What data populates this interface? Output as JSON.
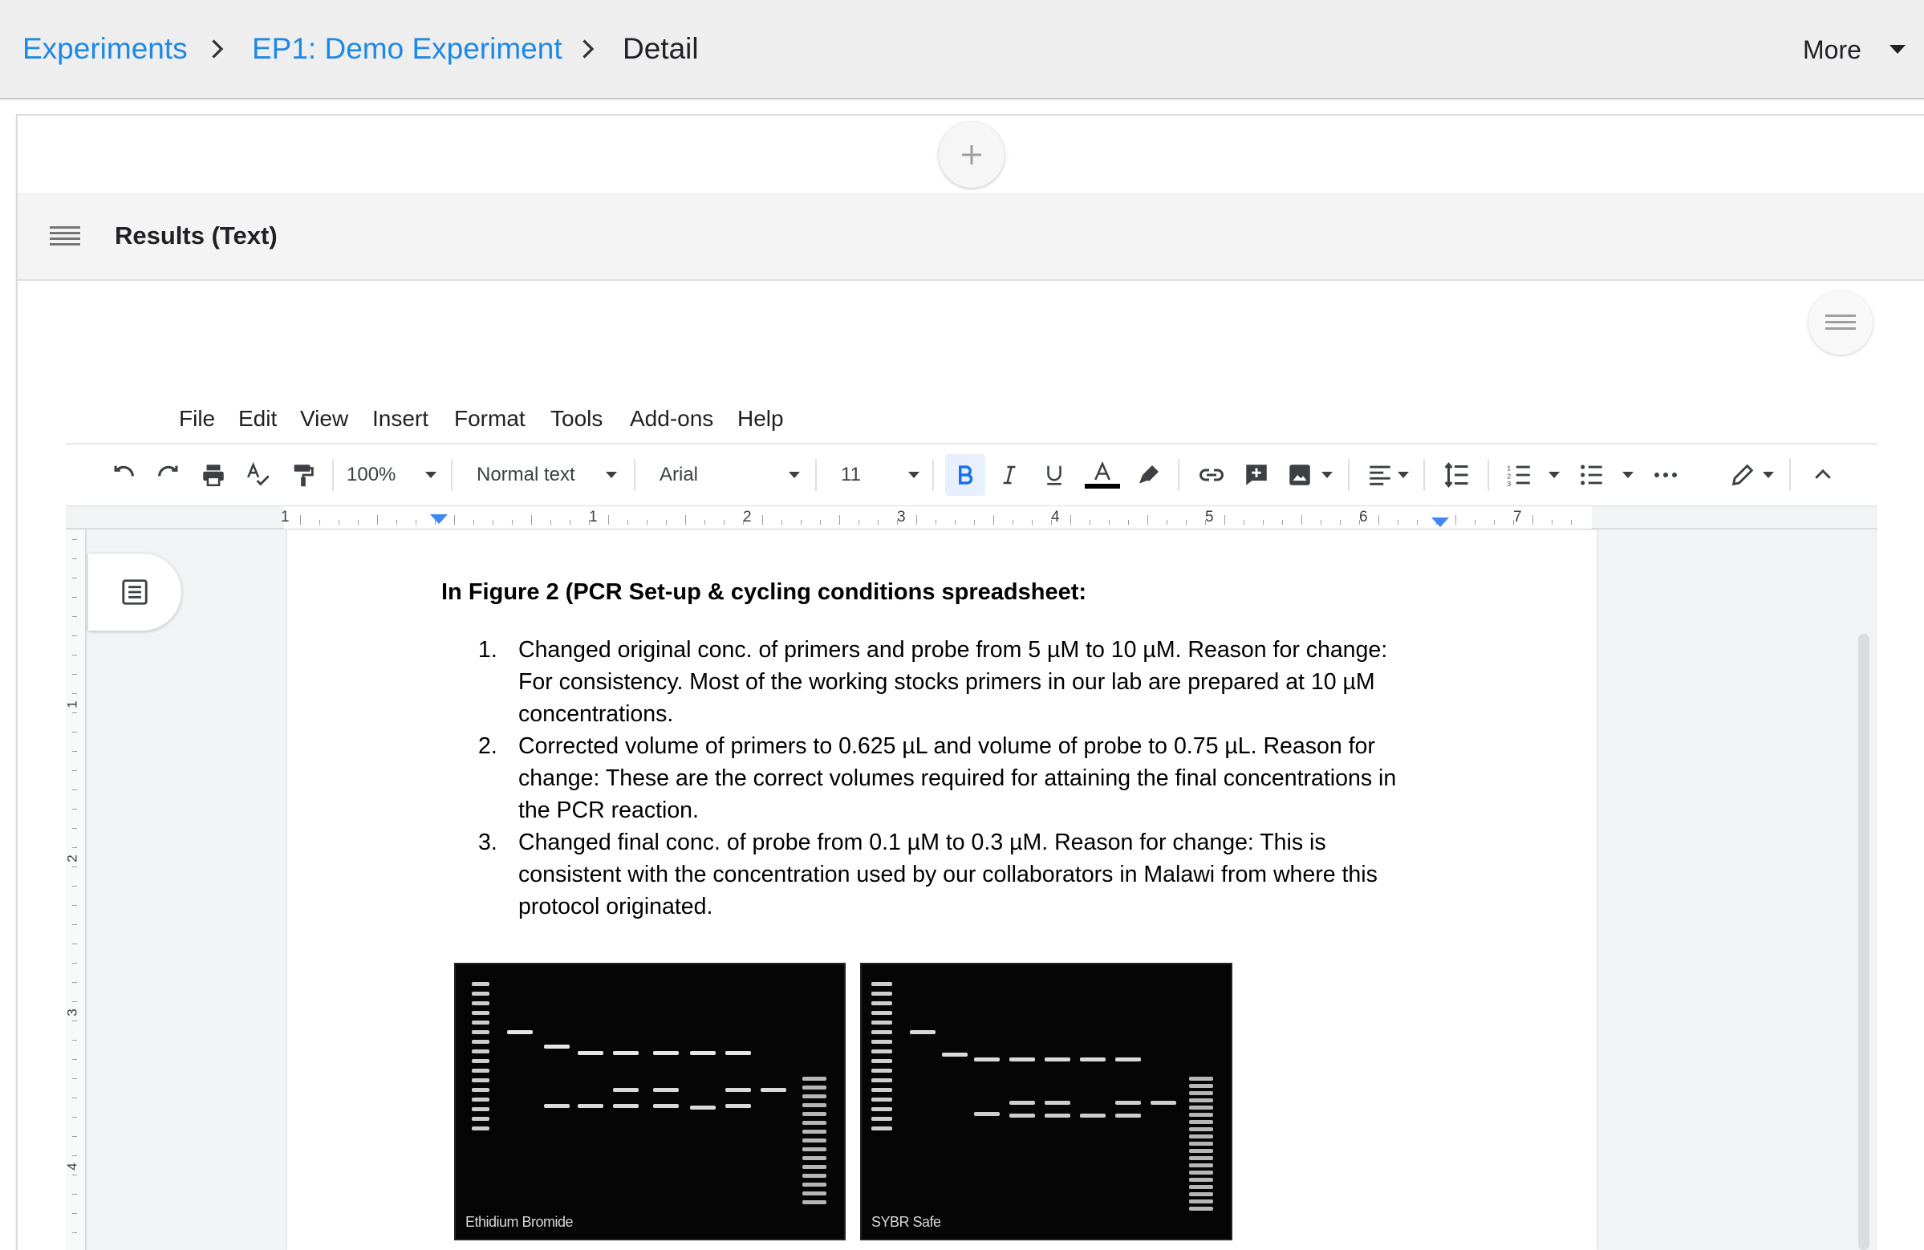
{
  "breadcrumb": {
    "experiments": "Experiments",
    "experiment": "EP1: Demo Experiment",
    "current": "Detail"
  },
  "header": {
    "more_label": "More"
  },
  "section": {
    "title": "Results (Text)"
  },
  "editor": {
    "menu": [
      "File",
      "Edit",
      "View",
      "Insert",
      "Format",
      "Tools",
      "Add-ons",
      "Help"
    ],
    "toolbar": {
      "zoom": "100%",
      "style": "Normal text",
      "font": "Arial",
      "size": "11",
      "bold_active": true
    },
    "ruler_numbers": [
      "1",
      "1",
      "2",
      "3",
      "4",
      "5",
      "6",
      "7"
    ],
    "vruler_numbers": [
      "1",
      "2",
      "3",
      "4"
    ]
  },
  "document": {
    "heading": "In Figure 2 (PCR Set-up & cycling conditions spreadsheet:",
    "items": [
      {
        "number": "1.",
        "lines": [
          "Changed original conc. of primers and probe from 5 µM to 10 µM. Reason for change:",
          "For consistency. Most of the working stocks primers in our lab are prepared at 10 µM",
          "concentrations."
        ]
      },
      {
        "number": "2.",
        "lines": [
          "Corrected volume of primers to 0.625 µL and volume of probe to 0.75 µL. Reason for",
          "change: These are the correct volumes required for attaining the final concentrations in",
          "the PCR reaction."
        ]
      },
      {
        "number": "3.",
        "lines": [
          "Changed final conc. of probe from 0.1 µM to 0.3 µM. Reason for change: This is",
          "consistent with the concentration used by our collaborators in Malawi from where this",
          "protocol originated."
        ]
      }
    ],
    "figure_labels": {
      "left": "Ethidium Bromide",
      "right": "SYBR Safe"
    }
  },
  "colors": {
    "link": "#1e88e5",
    "accent_blue": "#4285f4",
    "topbar": "#eeeeee"
  },
  "icons": [
    "chevron-right-icon",
    "caret-down-icon",
    "plus-icon",
    "hamburger-icon",
    "undo-icon",
    "redo-icon",
    "print-icon",
    "spellcheck-icon",
    "paint-format-icon",
    "bold-icon",
    "italic-icon",
    "underline-icon",
    "text-color-icon",
    "highlight-icon",
    "link-icon",
    "add-comment-icon",
    "insert-image-icon",
    "align-icon",
    "line-spacing-icon",
    "numbered-list-icon",
    "bulleted-list-icon",
    "more-icon",
    "edit-mode-icon",
    "collapse-icon",
    "document-outline-icon"
  ]
}
